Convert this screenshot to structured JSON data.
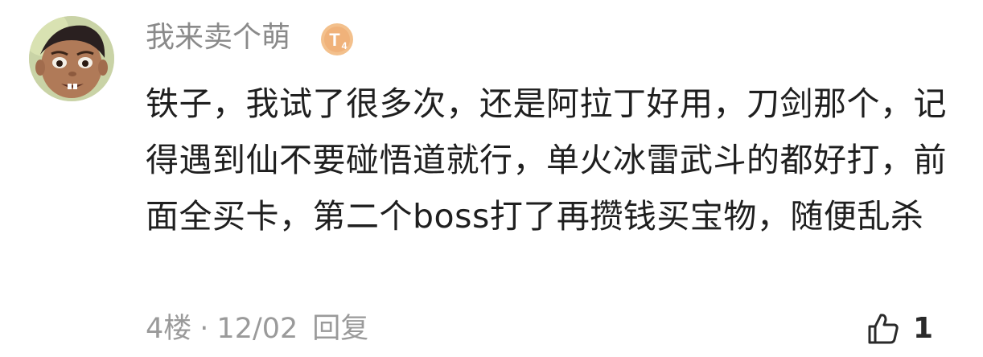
{
  "comment": {
    "username": "我来卖个萌",
    "level_badge_text": "T",
    "level_badge_number": "4",
    "content": "铁子，我试了很多次，还是阿拉丁好用，刀剑那个，记得遇到仙不要碰悟道就行，单火冰雷武斗的都好打，前面全买卡，第二个boss打了再攒钱买宝物，随便乱杀",
    "floor": "4楼",
    "separator": "·",
    "date": "12/02",
    "reply_label": "回复",
    "like_count": "1",
    "badge_color": "#f0b27a",
    "accent_icon": "thumb-up-icon"
  }
}
